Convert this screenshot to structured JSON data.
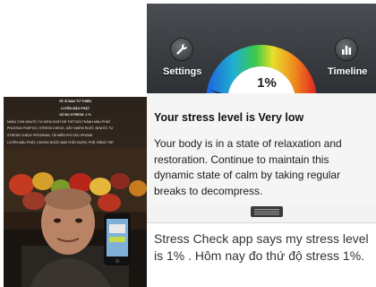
{
  "photo": {
    "text_lines": [
      "VỀ XỈ BAN TỪ THIỆN",
      "LUYỆN MẬU PHẬT",
      "SỐ ĐO STRESS: 1 %",
      "NHẬU CON NGƯỜI, TỰ KIỂM SOÁT ĐỂ THÍT ĐỐI THÀNH MẬU PHẬT",
      "PHƯƠNG PHÁP ĐO, STRESS CHECK, GẤY NHIỄM RUỘT, NHƯỚC TỰ",
      "STRESS CHECK PROGRAM, TẢI MIỄN PHÍ VÀO IPHONE",
      "LUYỆN MẬU PHẬT, CHỨNG NGỘC BẠN THẦY BUỒN, PHỆ, ĐĂNG THE"
    ]
  },
  "app": {
    "settings_label": "Settings",
    "timeline_label": "Timeline",
    "stress_value": "1%",
    "result_title": "Your stress level is Very low",
    "result_body": "Your body is in a state of relaxation and restoration. Continue to maintain this dynamic state of calm by taking regular breaks to decompress.",
    "colors": {
      "header_dark": "#2d3034",
      "gauge_needle": "#1a1a1a"
    }
  },
  "note": {
    "text": "Stress Check app says my stress level is 1% . Hôm nay đo thứ độ stress 1%."
  },
  "icons": [
    "wrench-icon",
    "bar-chart-icon",
    "drag-handle-icon"
  ]
}
